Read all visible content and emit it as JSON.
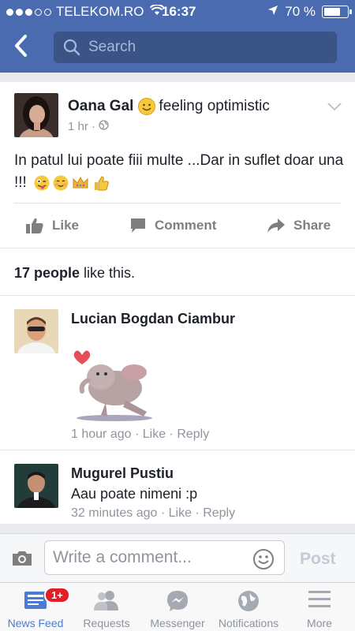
{
  "status": {
    "carrier": "TELEKOM.RO",
    "time": "16:37",
    "battery": "70 %",
    "battery_level": 0.7
  },
  "nav": {
    "search_placeholder": "Search"
  },
  "post": {
    "author": "Oana Gal",
    "feeling": "feeling optimistic",
    "time": "1 hr ·",
    "text": "In patul lui poate fiii multe ...Dar in suflet doar una !!!",
    "actions": {
      "like": "Like",
      "comment": "Comment",
      "share": "Share"
    },
    "likes": {
      "count": "17 people",
      "suffix": " like this."
    }
  },
  "comments": [
    {
      "name": "Lucian Bogdan Ciambur",
      "text": "",
      "time": "1 hour ago",
      "like": "Like",
      "reply": "Reply"
    },
    {
      "name": "Mugurel Pustiu",
      "text": "Aau poate nimeni :p",
      "time": "32 minutes ago",
      "like": "Like",
      "reply": "Reply"
    }
  ],
  "composer": {
    "placeholder": "Write a comment...",
    "post_label": "Post"
  },
  "tabs": [
    {
      "label": "News Feed",
      "badge": "1+"
    },
    {
      "label": "Requests"
    },
    {
      "label": "Messenger"
    },
    {
      "label": "Notifications"
    },
    {
      "label": "More"
    }
  ],
  "colors": {
    "header": "#4a6bb0",
    "search_bg": "#3b5487",
    "active_tab": "#4b7bd4",
    "badge": "#e41e26"
  }
}
